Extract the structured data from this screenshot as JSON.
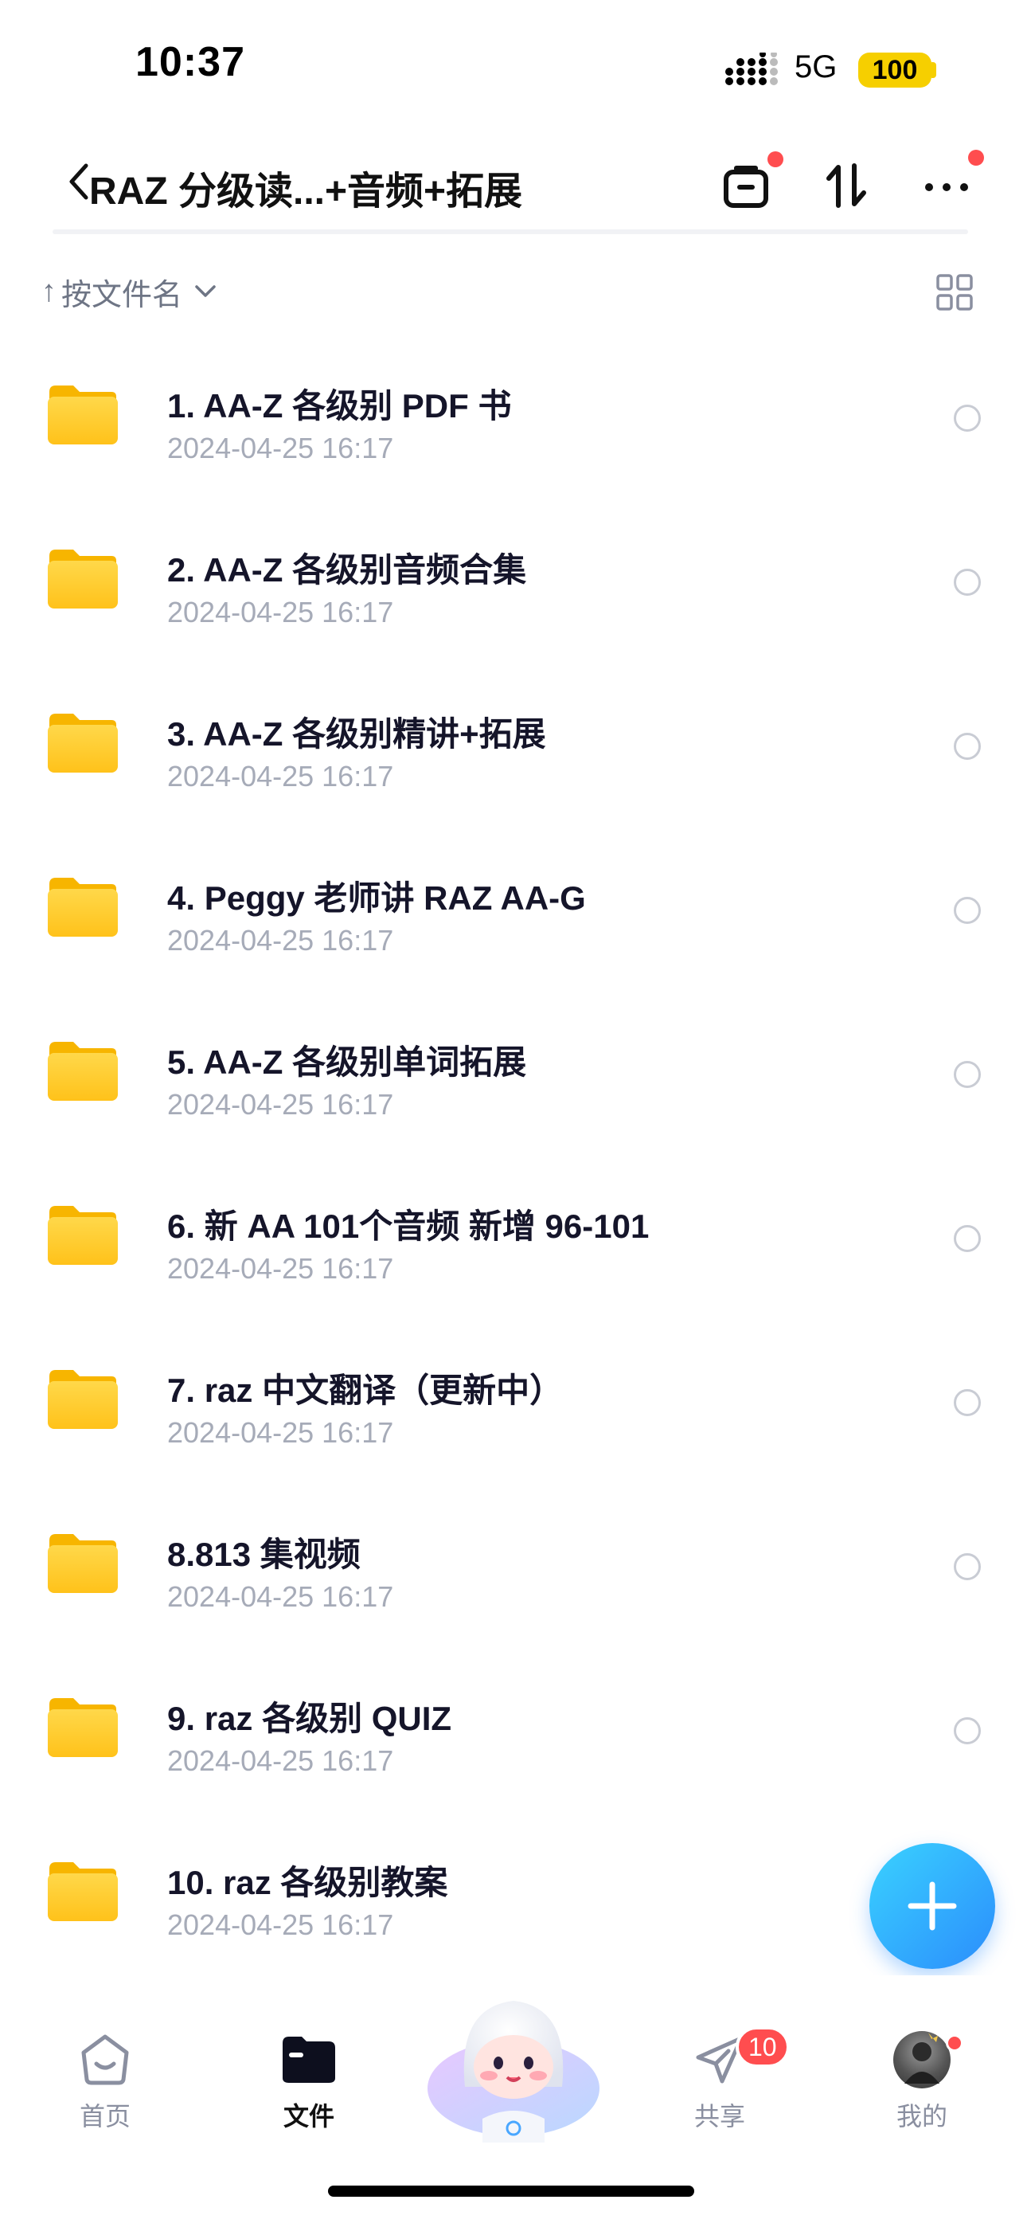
{
  "status_bar": {
    "time": "10:37",
    "network": "5G",
    "battery": "100",
    "colors": {
      "battery": "#f6cf00"
    }
  },
  "nav": {
    "title": "RAZ 分级读...+音频+拓展",
    "icons": [
      "chevron-left-icon",
      "transfer-box-icon",
      "sort-arrows-icon",
      "more-icon"
    ]
  },
  "sort": {
    "label": "按文件名",
    "arrow": "↑",
    "view_icon": "grid-view-icon"
  },
  "files": [
    {
      "name": "1. AA-Z 各级别 PDF 书",
      "date": "2024-04-25 16:17"
    },
    {
      "name": "2. AA-Z 各级别音频合集",
      "date": "2024-04-25 16:17"
    },
    {
      "name": "3. AA-Z 各级别精讲+拓展",
      "date": "2024-04-25 16:17"
    },
    {
      "name": "4. Peggy 老师讲 RAZ AA-G",
      "date": "2024-04-25 16:17"
    },
    {
      "name": "5. AA-Z 各级别单词拓展",
      "date": "2024-04-25 16:17"
    },
    {
      "name": "6. 新 AA 101个音频 新增 96-101",
      "date": "2024-04-25 16:17"
    },
    {
      "name": "7. raz 中文翻译（更新中）",
      "date": "2024-04-25 16:17"
    },
    {
      "name": "8.813 集视频",
      "date": "2024-04-25 16:17"
    },
    {
      "name": "9. raz 各级别 QUIZ",
      "date": "2024-04-25 16:17"
    },
    {
      "name": "10. raz 各级别教案",
      "date": "2024-04-25 16:17"
    }
  ],
  "fab": {
    "icon": "plus-icon",
    "colors": {
      "start": "#3ad2ff",
      "end": "#2b8dfc"
    }
  },
  "tab_bar": {
    "tabs": [
      {
        "label": "首页",
        "icon": "home-icon"
      },
      {
        "label": "文件",
        "icon": "folder-icon",
        "active": true
      },
      {
        "label": "",
        "icon": "mascot-icon"
      },
      {
        "label": "共享",
        "icon": "paper-plane-icon",
        "badge": "10"
      },
      {
        "label": "我的",
        "icon": "avatar"
      }
    ]
  }
}
